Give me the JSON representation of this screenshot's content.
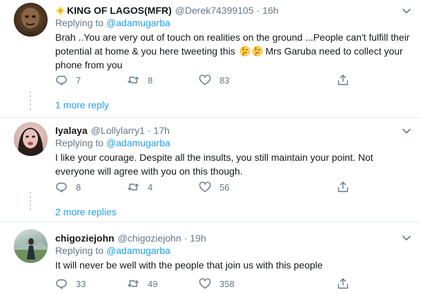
{
  "tweets": [
    {
      "name": "KING OF LAGOS(MFR)",
      "handle": "@Derek74399105",
      "time": "16h",
      "replying_prefix": "Replying to ",
      "replying_to": "@adamugarba",
      "text_before_emoji": "Brah ..You are very out of touch on realities on the ground ...People can't fulfill their potential at home & you here tweeting this",
      "text_after_emoji": " Mrs Garuba need to collect your phone from you",
      "replies": "7",
      "retweets": "8",
      "likes": "83",
      "more_replies": "1 more reply"
    },
    {
      "name": "Iyalaya",
      "handle": "@Lollylarry1",
      "time": "17h",
      "replying_prefix": "Replying to ",
      "replying_to": "@adamugarba",
      "text": "I like your courage. Despite all the insults, you still maintain your point. Not everyone will agree with you on this though.",
      "replies": "8",
      "retweets": "4",
      "likes": "56",
      "more_replies": "2 more replies"
    },
    {
      "name": "chigoziejohn",
      "handle": "@chigoziejohn",
      "time": "19h",
      "replying_prefix": "Replying to ",
      "replying_to": "@adamugarba",
      "text": "It will never be well with the people that join us with this people",
      "replies": "33",
      "retweets": "49",
      "likes": "358"
    }
  ],
  "separator": "·",
  "icons": {
    "reply": "reply-icon",
    "retweet": "retweet-icon",
    "like": "like-icon",
    "share": "share-icon",
    "caret": "chevron-down-icon",
    "name_emoji": "sun-emoji-icon",
    "thinking_emoji": "thinking-face-emoji-icon"
  },
  "colors": {
    "link": "#1da1f2",
    "secondary_text": "#657786",
    "primary_text": "#14171a",
    "divider": "#e6ecf0"
  }
}
